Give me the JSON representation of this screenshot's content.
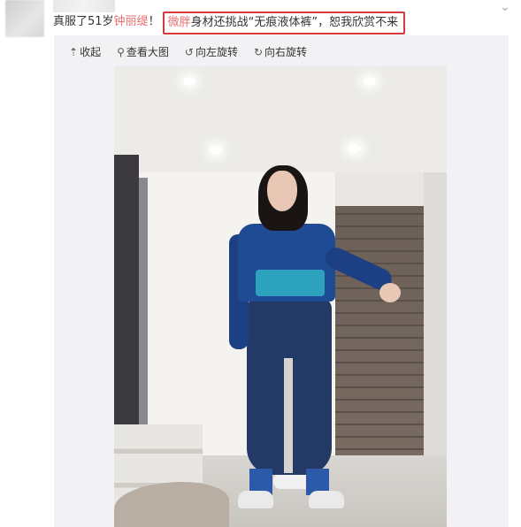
{
  "post": {
    "prefix": "真服了51岁",
    "name_highlight": "钟丽缇",
    "exclaim": "！",
    "quote_highlight": "微胖",
    "quote_rest": "身材还挑战“无痕液体裤”，恕我欣赏不来"
  },
  "toolbar": {
    "items": [
      {
        "icon": "collapse-icon",
        "glyph": "⇡",
        "label": "收起"
      },
      {
        "icon": "zoom-icon",
        "glyph": "⚲",
        "label": "查看大图"
      },
      {
        "icon": "rotate-left-icon",
        "glyph": "↺",
        "label": "向左旋转"
      },
      {
        "icon": "rotate-right-icon",
        "glyph": "↻",
        "label": "向右旋转"
      }
    ]
  },
  "more": {
    "glyph": "⌄"
  },
  "colors": {
    "highlight": "#e86f6f",
    "box_border": "#d43b3b",
    "panel_bg": "#f2f2f5"
  }
}
